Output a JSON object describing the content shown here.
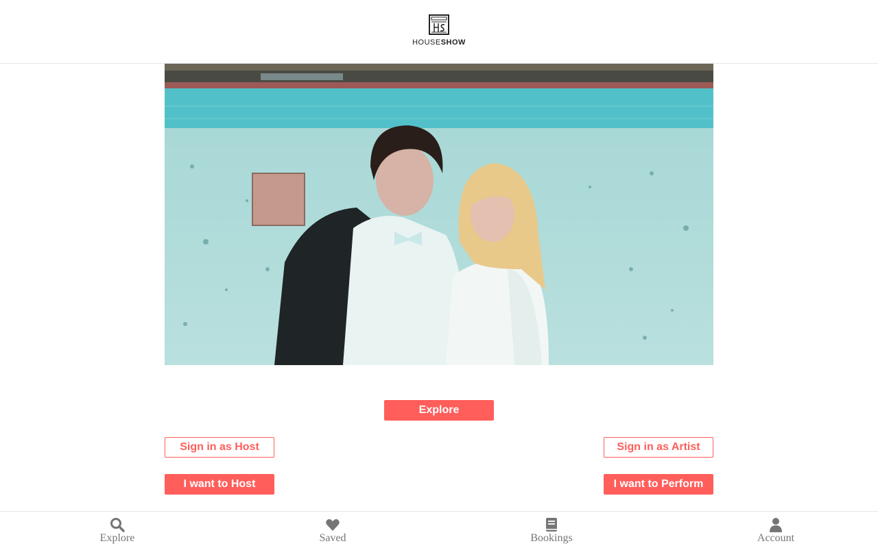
{
  "header": {
    "logo_mark": "HS",
    "logo_text_light": "HOUSE",
    "logo_text_bold": "SHOW"
  },
  "actions": {
    "explore_label": "Explore",
    "sign_in_host_label": "Sign in as Host",
    "sign_in_artist_label": "Sign in as Artist",
    "want_host_label": "I want to Host",
    "want_perform_label": "I want to Perform"
  },
  "nav": {
    "items": [
      {
        "label": "Explore",
        "icon": "search-icon"
      },
      {
        "label": "Saved",
        "icon": "heart-icon"
      },
      {
        "label": "Bookings",
        "icon": "book-icon"
      },
      {
        "label": "Account",
        "icon": "user-icon"
      }
    ]
  },
  "colors": {
    "accent": "#ff5e5b",
    "nav_text": "#757575"
  }
}
